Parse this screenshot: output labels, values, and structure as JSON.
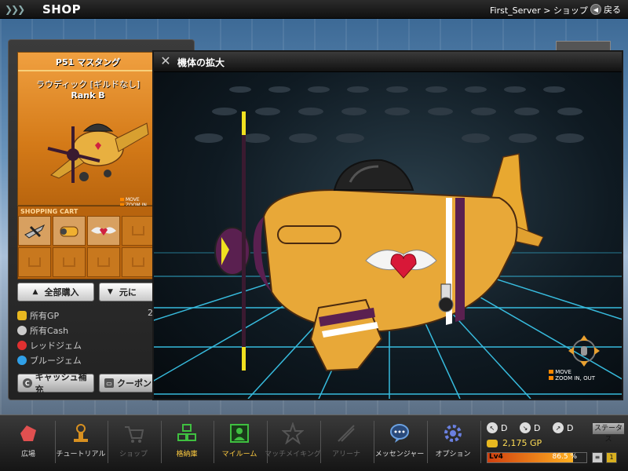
{
  "topbar": {
    "title": "SHOP",
    "breadcrumb": "First_Server > ショップ",
    "back_label": "戻る"
  },
  "item": {
    "name": "P51 マスタング",
    "guild": "ラウディック [ギルドなし]",
    "rank": "Rank  B",
    "mini_legend": [
      "MOVE",
      "ZOOM IN"
    ]
  },
  "cart": {
    "label": "SHOPPING CART"
  },
  "buttons": {
    "buy_all": "全部購入",
    "restore": "元に"
  },
  "currency": {
    "gp_label": "所有GP",
    "gp_value": "2",
    "cash_label": "所有Cash",
    "red_gem_label": "レッドジェム",
    "blue_gem_label": "ブルージェム"
  },
  "bottom_buttons": {
    "charge": "キャッシュ補充",
    "coupon": "クーポン"
  },
  "modal": {
    "title": "機体の拡大",
    "legend": [
      "MOVE",
      "ZOOM IN, OUT"
    ]
  },
  "nav": [
    {
      "label": "広場",
      "icon": "plaza-icon",
      "state": "normal"
    },
    {
      "label": "チュートリアル",
      "icon": "tutorial-icon",
      "state": "normal"
    },
    {
      "label": "ショップ",
      "icon": "shop-icon",
      "state": "disabled"
    },
    {
      "label": "格納庫",
      "icon": "hangar-icon",
      "state": "active"
    },
    {
      "label": "マイルーム",
      "icon": "myroom-icon",
      "state": "active"
    },
    {
      "label": "マッチメイキング",
      "icon": "matchmaking-icon",
      "state": "disabled"
    },
    {
      "label": "アリーナ",
      "icon": "arena-icon",
      "state": "disabled"
    },
    {
      "label": "メッセンジャー",
      "icon": "messenger-icon",
      "state": "normal"
    },
    {
      "label": "オプション",
      "icon": "options-icon",
      "state": "normal"
    }
  ],
  "status": {
    "stats": [
      "D",
      "D",
      "D"
    ],
    "status_button": "ステータス",
    "gp": "2,175 GP",
    "level": "Lv4",
    "exp_percent": "86.5 %",
    "exp_fraction": 0.865
  },
  "colors": {
    "card_orange": "#d47a18",
    "grid_cyan": "#3fd8ff",
    "gold": "#ffdd55"
  }
}
